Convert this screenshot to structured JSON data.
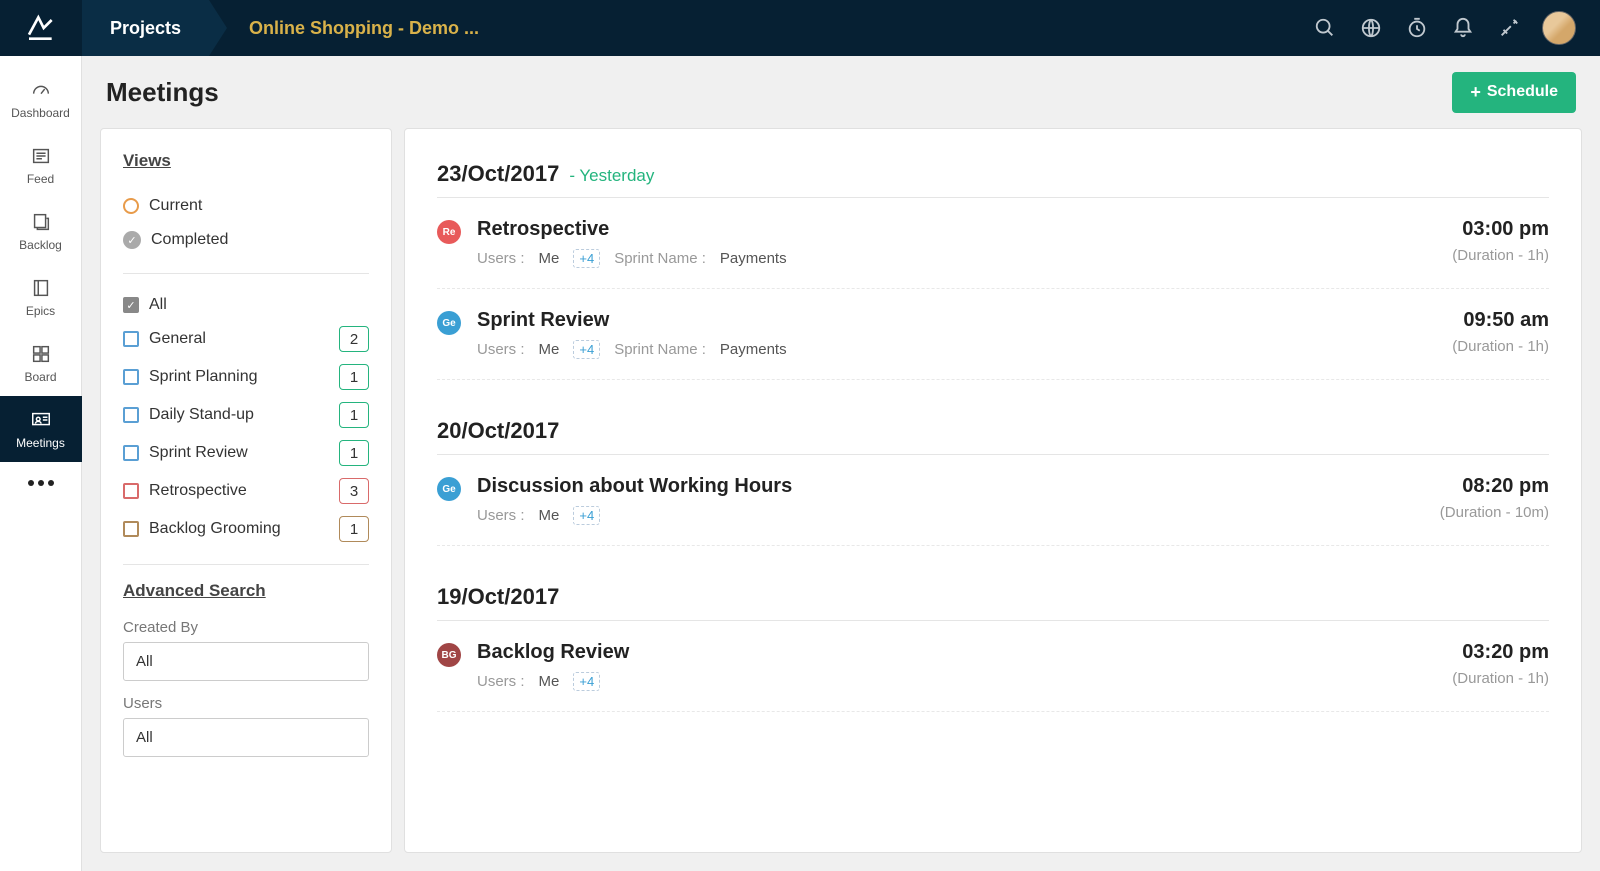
{
  "topbar": {
    "projects_label": "Projects",
    "project_name": "Online Shopping - Demo ..."
  },
  "leftnav": {
    "items": [
      {
        "label": "Dashboard"
      },
      {
        "label": "Feed"
      },
      {
        "label": "Backlog"
      },
      {
        "label": "Epics"
      },
      {
        "label": "Board"
      },
      {
        "label": "Meetings"
      }
    ]
  },
  "page": {
    "title": "Meetings",
    "schedule_btn": "Schedule"
  },
  "filters": {
    "views_title": "Views",
    "view_current": "Current",
    "view_completed": "Completed",
    "all_label": "All",
    "categories": [
      {
        "label": "General",
        "count": "2",
        "box": "blue",
        "badge": "green"
      },
      {
        "label": "Sprint Planning",
        "count": "1",
        "box": "blue",
        "badge": "green"
      },
      {
        "label": "Daily Stand-up",
        "count": "1",
        "box": "blue",
        "badge": "green"
      },
      {
        "label": "Sprint Review",
        "count": "1",
        "box": "blue",
        "badge": "green"
      },
      {
        "label": "Retrospective",
        "count": "3",
        "box": "red",
        "badge": "red-b"
      },
      {
        "label": "Backlog Grooming",
        "count": "1",
        "box": "brown",
        "badge": "brown-b"
      }
    ],
    "advanced_title": "Advanced Search",
    "created_by_label": "Created By",
    "created_by_value": "All",
    "users_label": "Users",
    "users_value": "All"
  },
  "meta_labels": {
    "users": "Users :",
    "me": "Me",
    "sprint_name": "Sprint Name :"
  },
  "groups": [
    {
      "date": "23/Oct/2017",
      "relative": "- Yesterday",
      "meetings": [
        {
          "tag": "Re",
          "tag_class": "tag-re",
          "title": "Retrospective",
          "extra": "+4",
          "sprint": "Payments",
          "time": "03:00 pm",
          "duration": "(Duration - 1h)"
        },
        {
          "tag": "Ge",
          "tag_class": "tag-ge",
          "title": "Sprint Review",
          "extra": "+4",
          "sprint": "Payments",
          "time": "09:50 am",
          "duration": "(Duration - 1h)"
        }
      ]
    },
    {
      "date": "20/Oct/2017",
      "relative": "",
      "meetings": [
        {
          "tag": "Ge",
          "tag_class": "tag-ge",
          "title": "Discussion about Working Hours",
          "extra": "+4",
          "sprint": "",
          "time": "08:20 pm",
          "duration": "(Duration - 10m)"
        }
      ]
    },
    {
      "date": "19/Oct/2017",
      "relative": "",
      "meetings": [
        {
          "tag": "BG",
          "tag_class": "tag-bg",
          "title": "Backlog Review",
          "extra": "+4",
          "sprint": "",
          "time": "03:20 pm",
          "duration": "(Duration - 1h)"
        }
      ]
    }
  ]
}
